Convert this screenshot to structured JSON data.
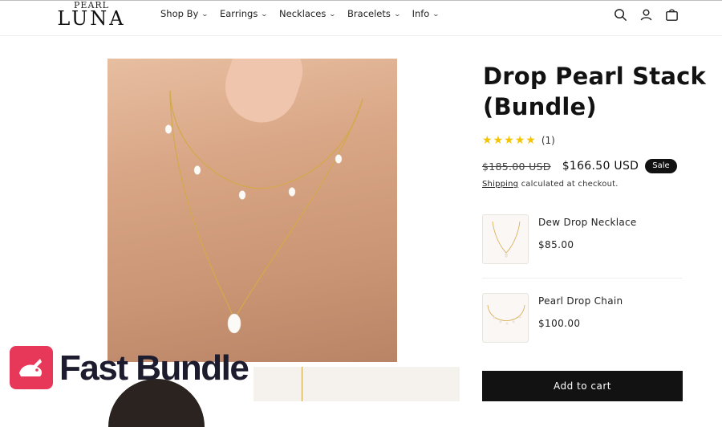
{
  "header": {
    "logo_small": "PEARL",
    "logo_big": "LUNA",
    "nav": [
      {
        "label": "Shop By"
      },
      {
        "label": "Earrings"
      },
      {
        "label": "Necklaces"
      },
      {
        "label": "Bracelets"
      },
      {
        "label": "Info"
      }
    ],
    "icons": [
      "search-icon",
      "account-icon",
      "cart-icon"
    ]
  },
  "product": {
    "title": "Drop Pearl Stack (Bundle)",
    "rating_stars": 5,
    "review_count": "(1)",
    "old_price": "$185.00 USD",
    "new_price": "$166.50 USD",
    "badge": "Sale",
    "shipping_link": "Shipping",
    "shipping_text": " calculated at checkout.",
    "bundle_items": [
      {
        "name": "Dew Drop Necklace",
        "price": "$85.00"
      },
      {
        "name": "Pearl Drop Chain",
        "price": "$100.00"
      }
    ],
    "add_to_cart": "Add to cart"
  },
  "overlay": {
    "brand": "Fast Bundle"
  },
  "colors": {
    "accent": "#121212",
    "star": "#f5c400",
    "brand_pink": "#e8385a",
    "gold": "#d4a94a"
  }
}
